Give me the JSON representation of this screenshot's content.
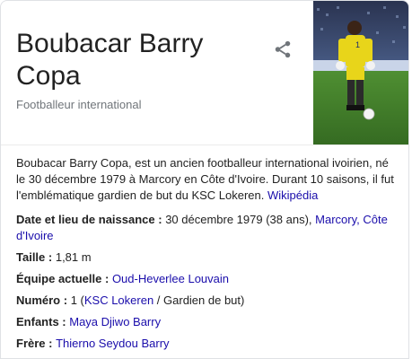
{
  "header": {
    "title": "Boubacar Barry Copa",
    "subtitle": "Footballeur international",
    "share_icon": "share-icon"
  },
  "description": {
    "text": "Boubacar Barry Copa, est un ancien footballeur international ivoirien, né le 30 décembre 1979 à Marcory en Côte d'Ivoire. Durant 10 saisons, il fut l'emblématique gardien de but du KSC Lokeren.",
    "source_link": "Wikipédia"
  },
  "facts": {
    "birth": {
      "label": "Date et lieu de naissance",
      "value": "30 décembre 1979 (38 ans),",
      "link": "Marcory, Côte d'Ivoire"
    },
    "height": {
      "label": "Taille",
      "value": "1,81 m"
    },
    "team": {
      "label": "Équipe actuelle",
      "link": "Oud-Heverlee Louvain"
    },
    "number": {
      "label": "Numéro",
      "value_before": "1 (",
      "link": "KSC Lokeren",
      "value_after": " / Gardien de but)"
    },
    "children": {
      "label": "Enfants",
      "link": "Maya Djiwo Barry"
    },
    "brother": {
      "label": "Frère",
      "link": "Thierno Seydou Barry"
    }
  },
  "colors": {
    "link": "#1a0dab",
    "text": "#222222",
    "secondary": "#70757a",
    "pitch": "#3f7a2a"
  }
}
